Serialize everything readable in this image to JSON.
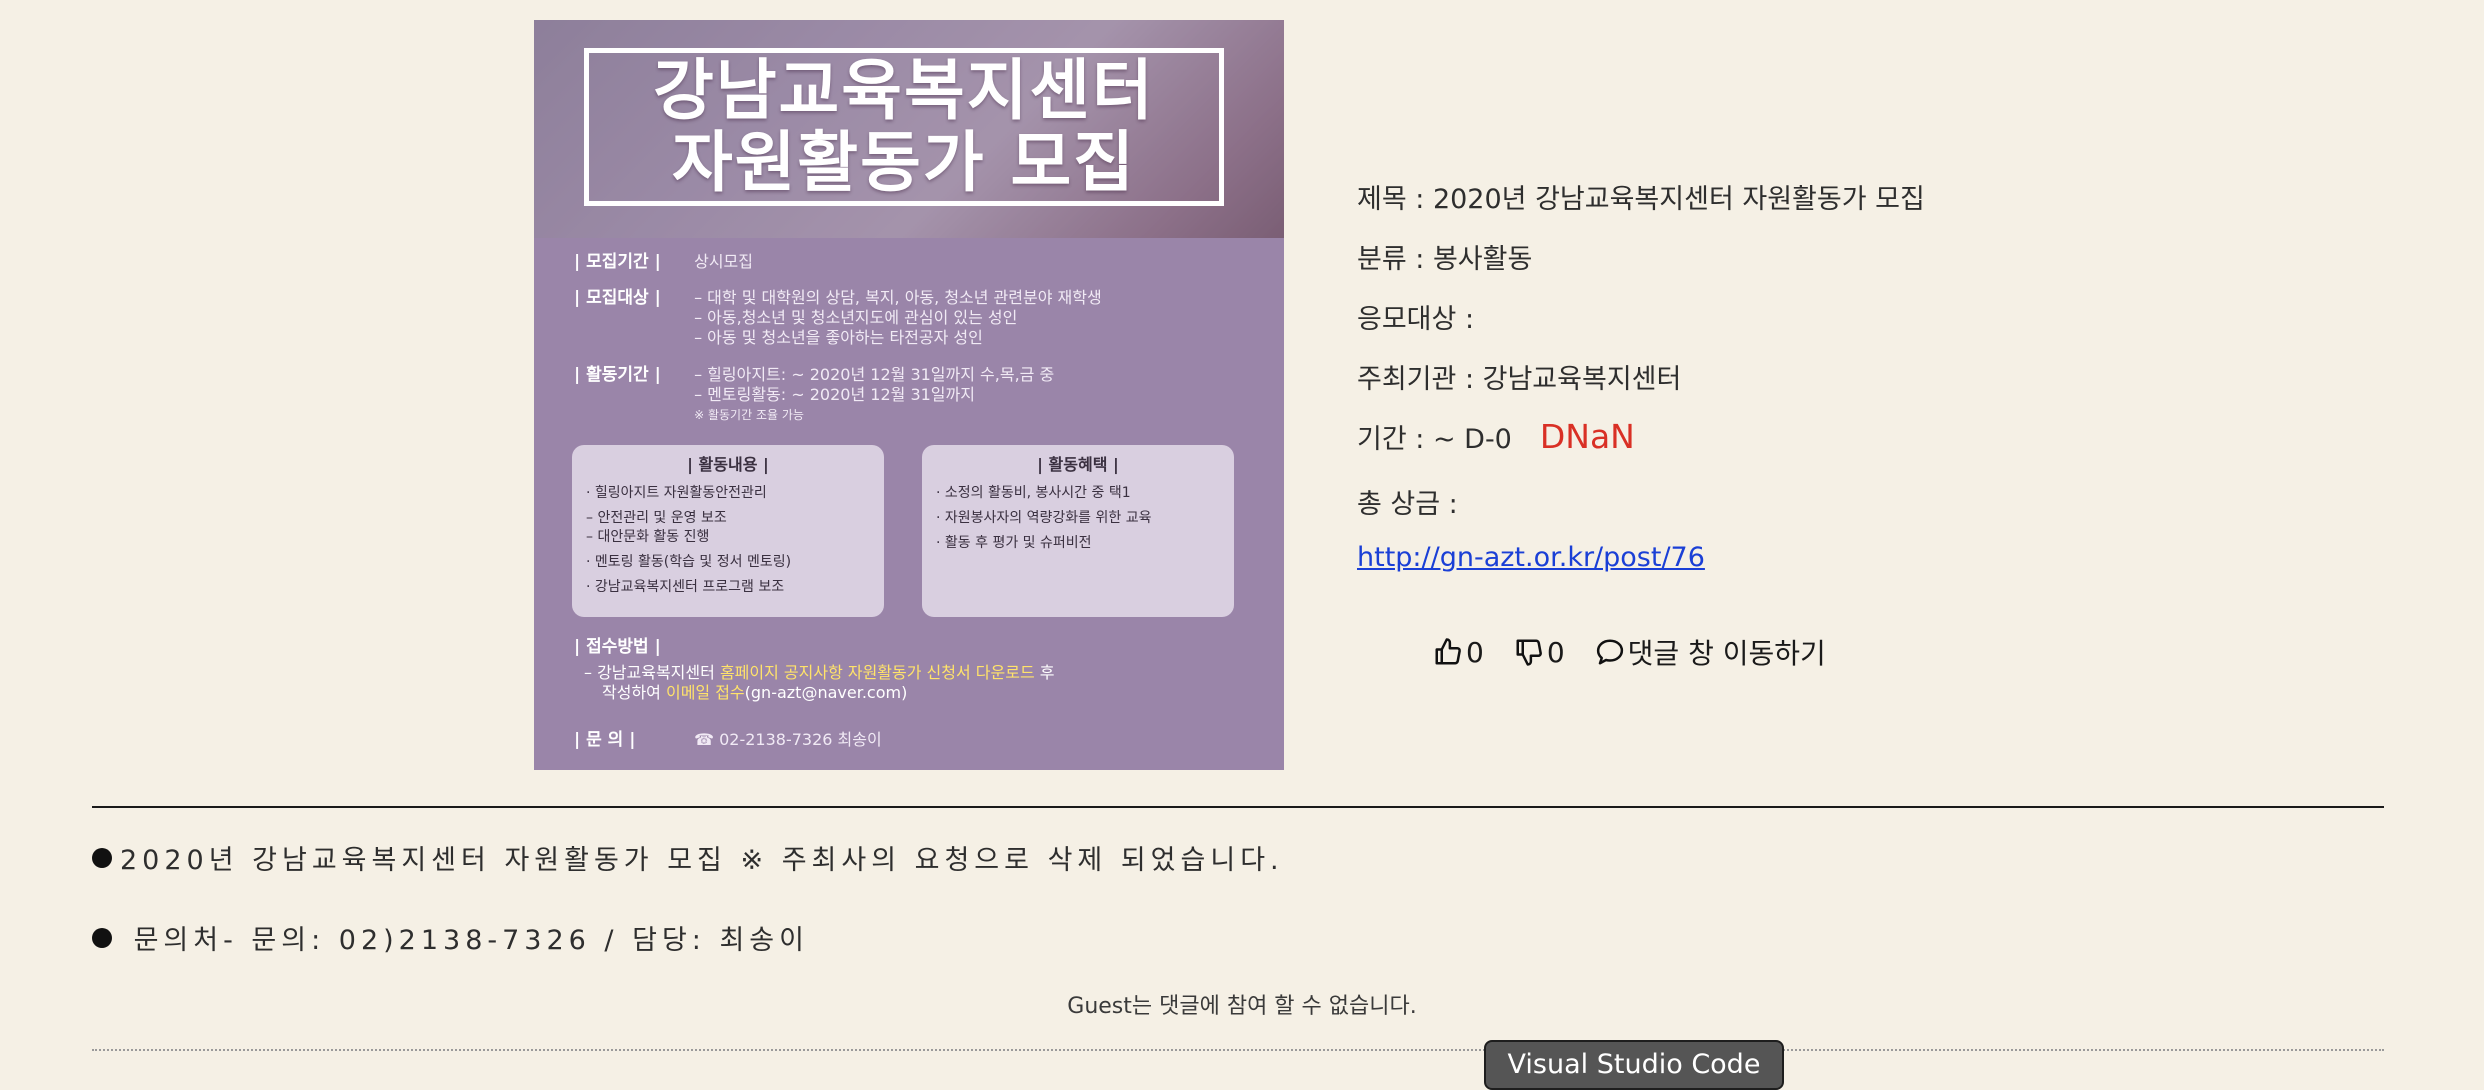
{
  "poster": {
    "title_line1": "강남교육복지센터",
    "title_line2": "자원활동가 모집",
    "rows": [
      {
        "label": "| 모집기간 |",
        "lines": [
          "상시모집"
        ]
      },
      {
        "label": "| 모집대상 |",
        "lines": [
          "– 대학 및 대학원의 상담, 복지, 아동, 청소년 관련분야 재학생",
          "– 아동,청소년 및 청소년지도에 관심이 있는 성인",
          "– 아동 및 청소년을 좋아하는 타전공자 성인"
        ]
      },
      {
        "label": "| 활동기간 |",
        "lines": [
          "– 힐링아지트: ~ 2020년 12월 31일까지 수,목,금 중",
          "– 멘토링활동: ~ 2020년 12월 31일까지"
        ],
        "note": "※ 활동기간 조율 가능"
      }
    ],
    "card_left": {
      "title": "| 활동내용 |",
      "items": [
        "· 힐링아지트 자원활동안전관리",
        "  – 안전관리 및 운영 보조",
        "  – 대안문화 활동 진행",
        "· 멘토링 활동(학습 및 정서 멘토링)",
        "· 강남교육복지센터 프로그램 보조"
      ]
    },
    "card_right": {
      "title": "| 활동혜택 |",
      "items": [
        "· 소정의 활동비, 봉사시간 중 택1",
        "· 자원봉사자의 역량강화를 위한 교육",
        "· 활동 후 평가 및 슈퍼비전"
      ]
    },
    "apply": {
      "label": "| 접수방법 |",
      "line1_a": "– 강남교육복지센터 ",
      "line1_b": "홈페이지 공지사항 자원활동가 신청서 다운로드",
      "line1_c": " 후",
      "line2_a": "작성하여 ",
      "line2_b": "이메일 접수",
      "line2_c": "(gn-azt@naver.com)"
    },
    "contact": {
      "label": "| 문      의 |",
      "value": "☎ 02-2138-7326 최송이"
    }
  },
  "info": {
    "title": "제목 : 2020년 강남교육복지센터 자원활동가 모집",
    "category": "분류 : 봉사활동",
    "target": "응모대상 :",
    "organizer": "주최기관 : 강남교육복지센터",
    "period": "기간 : ~ D-0",
    "dday": "DNaN",
    "prize": "총 상금 :",
    "link": "http://gn-azt.or.kr/post/76"
  },
  "actions": {
    "like_count": "0",
    "dislike_count": "0",
    "comment_label": "댓글 창 이동하기",
    "like_icon": "thumbs-up-icon",
    "dislike_icon": "thumbs-down-icon",
    "comment_icon": "speech-bubble-icon"
  },
  "notices": {
    "line1": "2020년 강남교육복지센터 자원활동가 모집 ※ 주최사의 요청으로 삭제 되었습니다.",
    "line2": " 문의처- 문의: 02)2138-7326 / 담당: 최송이"
  },
  "guest_text": "Guest는 댓글에 참여 할 수 없습니다.",
  "tooltip": "Visual Studio Code",
  "colors": {
    "background": "#f5f0e5",
    "dday": "#d93025",
    "link": "#1a3fd6",
    "poster": "#9a85a9"
  }
}
